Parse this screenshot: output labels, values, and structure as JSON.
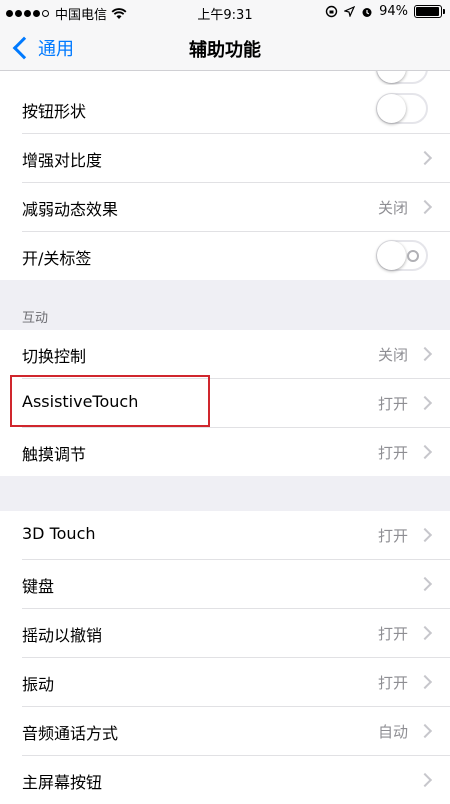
{
  "status_bar": {
    "carrier": "中国电信",
    "time": "上午9:31",
    "battery_text": "94%",
    "battery_level": 0.94
  },
  "nav": {
    "back_label": "通用",
    "title": "辅助功能"
  },
  "group1": [
    {
      "label": "按钮形状",
      "toggle": "off"
    },
    {
      "label": "增强对比度"
    },
    {
      "label": "减弱动态效果",
      "value": "关闭"
    },
    {
      "label": "开/关标签",
      "toggle": "off"
    }
  ],
  "section2_header": "互动",
  "group2": [
    {
      "label": "切换控制",
      "value": "关闭"
    },
    {
      "label": "AssistiveTouch",
      "value": "打开"
    },
    {
      "label": "触摸调节",
      "value": "打开"
    }
  ],
  "group3": [
    {
      "label": "3D Touch",
      "value": "打开"
    },
    {
      "label": "键盘"
    },
    {
      "label": "摇动以撤销",
      "value": "打开"
    },
    {
      "label": "振动",
      "value": "打开"
    },
    {
      "label": "音频通话方式",
      "value": "自动"
    },
    {
      "label": "主屏幕按钮"
    }
  ],
  "colors": {
    "accent": "#007aff",
    "highlight_border": "#d0262d",
    "background": "#efeff4"
  }
}
